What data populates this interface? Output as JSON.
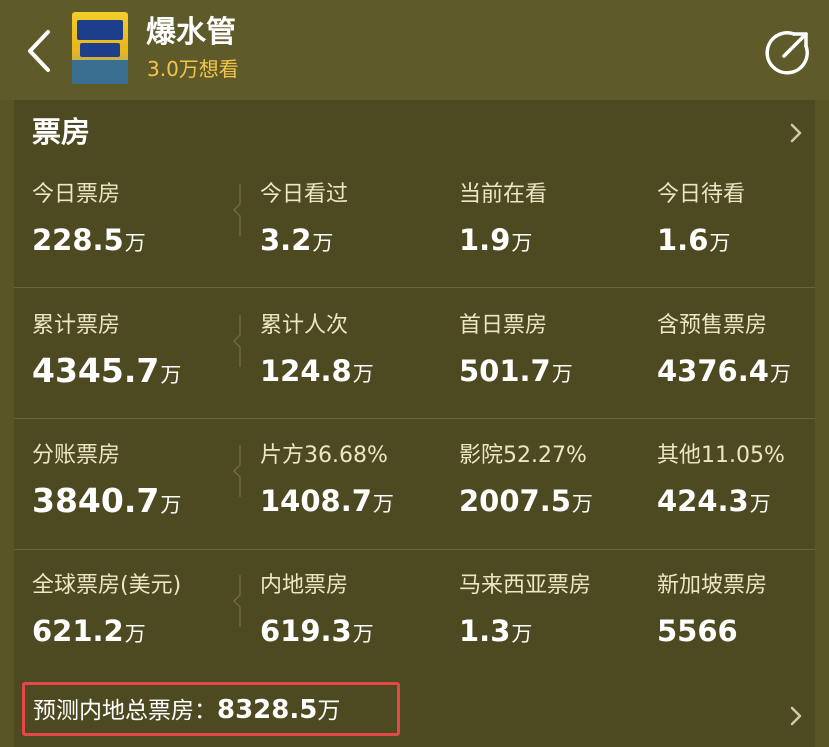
{
  "header": {
    "title": "爆水管",
    "want_count": "3.0万想看"
  },
  "section": {
    "title": "票房"
  },
  "rows": [
    [
      {
        "label": "今日票房",
        "value": "228.5",
        "unit": "万"
      },
      {
        "label": "今日看过",
        "value": "3.2",
        "unit": "万"
      },
      {
        "label": "当前在看",
        "value": "1.9",
        "unit": "万"
      },
      {
        "label": "今日待看",
        "value": "1.6",
        "unit": "万"
      }
    ],
    [
      {
        "label": "累计票房",
        "value": "4345.7",
        "unit": "万"
      },
      {
        "label": "累计人次",
        "value": "124.8",
        "unit": "万"
      },
      {
        "label": "首日票房",
        "value": "501.7",
        "unit": "万"
      },
      {
        "label": "含预售票房",
        "value": "4376.4",
        "unit": "万"
      }
    ],
    [
      {
        "label": "分账票房",
        "value": "3840.7",
        "unit": "万"
      },
      {
        "label": "片方36.68%",
        "value": "1408.7",
        "unit": "万"
      },
      {
        "label": "影院52.27%",
        "value": "2007.5",
        "unit": "万"
      },
      {
        "label": "其他11.05%",
        "value": "424.3",
        "unit": "万"
      }
    ],
    [
      {
        "label": "全球票房(美元)",
        "value": "621.2",
        "unit": "万"
      },
      {
        "label": "内地票房",
        "value": "619.3",
        "unit": "万"
      },
      {
        "label": "马来西亚票房",
        "value": "1.3",
        "unit": "万"
      },
      {
        "label": "新加坡票房",
        "value": "5566",
        "unit": ""
      }
    ]
  ],
  "prediction": {
    "label": "预测内地总票房：",
    "value": "8328.5",
    "unit": "万"
  },
  "colors": {
    "background": "#5a5527",
    "panel": "#4d4921",
    "accent_want": "#f4c54a",
    "highlight_border": "#e8474a"
  }
}
